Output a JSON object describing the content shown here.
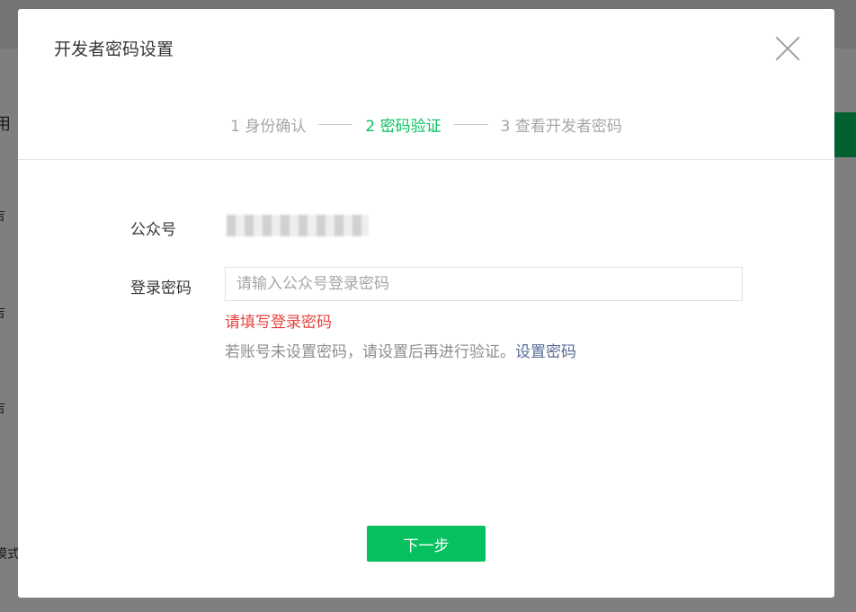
{
  "background": {
    "side_texts": [
      "用",
      "吉",
      "吉",
      "吉",
      "模式"
    ]
  },
  "dialog": {
    "title": "开发者密码设置",
    "close_icon": "close-icon"
  },
  "steps": [
    {
      "label": "1 身份确认",
      "active": false
    },
    {
      "label": "2 密码验证",
      "active": true
    },
    {
      "label": "3 查看开发者密码",
      "active": false
    }
  ],
  "form": {
    "account_label": "公众号",
    "password_label": "登录密码",
    "password_placeholder": "请输入公众号登录密码",
    "password_value": "",
    "error": "请填写登录密码",
    "tip": "若账号未设置密码，请设置后再进行验证。",
    "tip_link": "设置密码"
  },
  "actions": {
    "next_label": "下一步"
  },
  "colors": {
    "accent": "#07c160",
    "error": "#e64340",
    "link": "#576b95"
  }
}
